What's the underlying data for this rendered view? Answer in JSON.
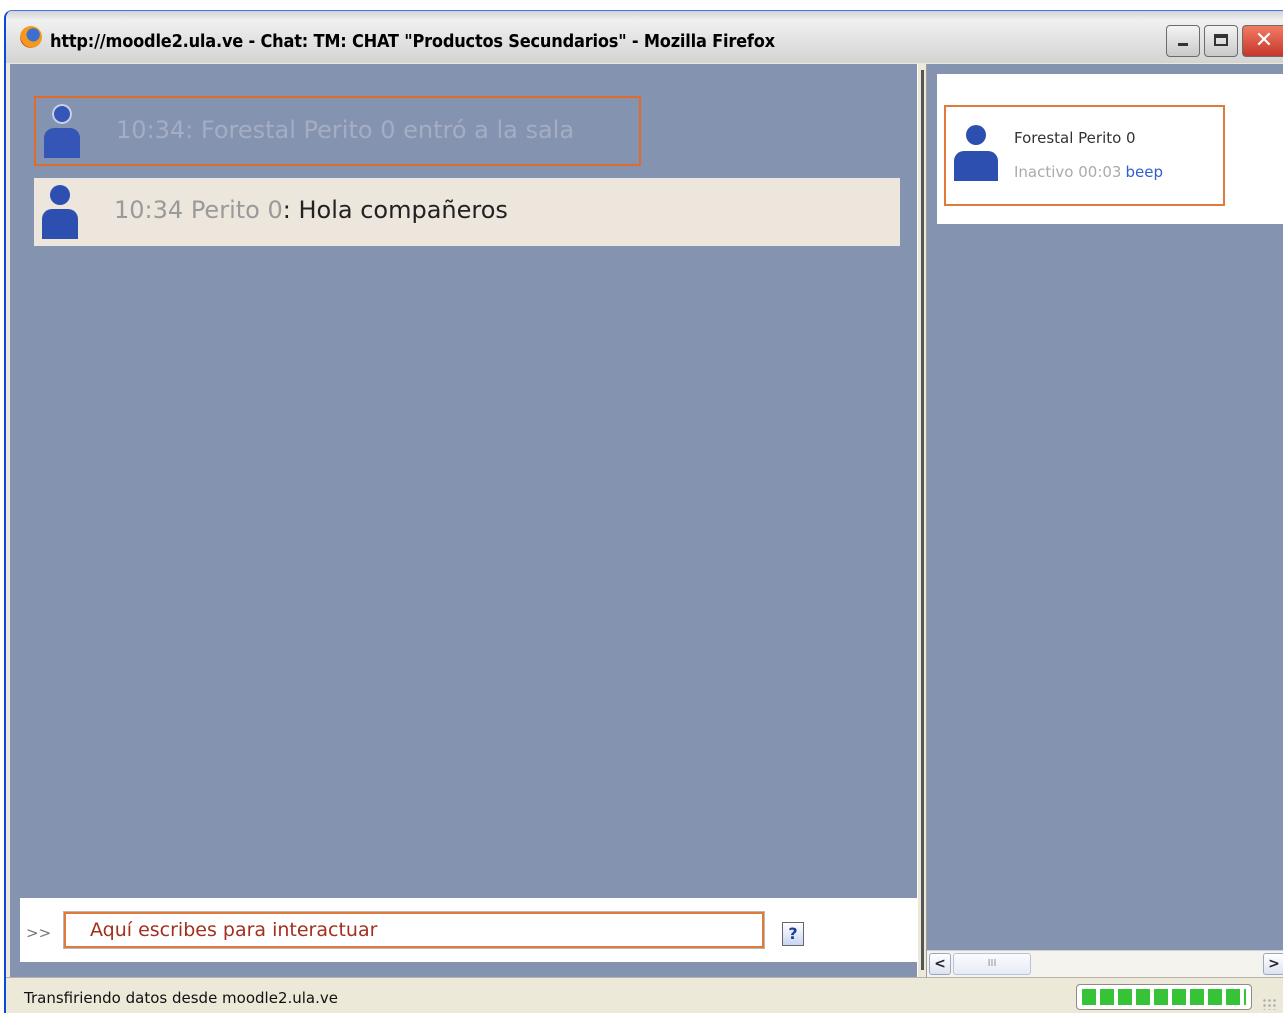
{
  "window": {
    "title": "http://moodle2.ula.ve - Chat: TM: CHAT \"Productos Secundarios\" - Mozilla Firefox",
    "buttons": {
      "minimize": "minimize",
      "maximize": "maximize",
      "close": "✕"
    }
  },
  "chat": {
    "system_message": {
      "time": "10:34:",
      "text": "Forestal Perito 0 entró a la sala"
    },
    "message": {
      "time": "10:34",
      "name": "Perito 0",
      "separator": ":",
      "text": "Hola compañeros"
    },
    "input": {
      "prompt": ">>",
      "placeholder": "Aquí escribes para interactuar",
      "help": "?"
    }
  },
  "users": {
    "list": [
      {
        "name": "Forestal Perito 0",
        "status": "Inactivo 00:03",
        "action": "beep"
      }
    ]
  },
  "statusbar": {
    "text": "Transfiriendo datos desde moodle2.ula.ve",
    "progress": 1.0
  },
  "scrollbar": {
    "thumb_grip": "III"
  },
  "colors": {
    "pane_bg": "#8494b0",
    "accent_border": "#e07a3a",
    "avatar": "#2c4fb0",
    "link": "#2f5fd0",
    "progress": "#37c337"
  }
}
